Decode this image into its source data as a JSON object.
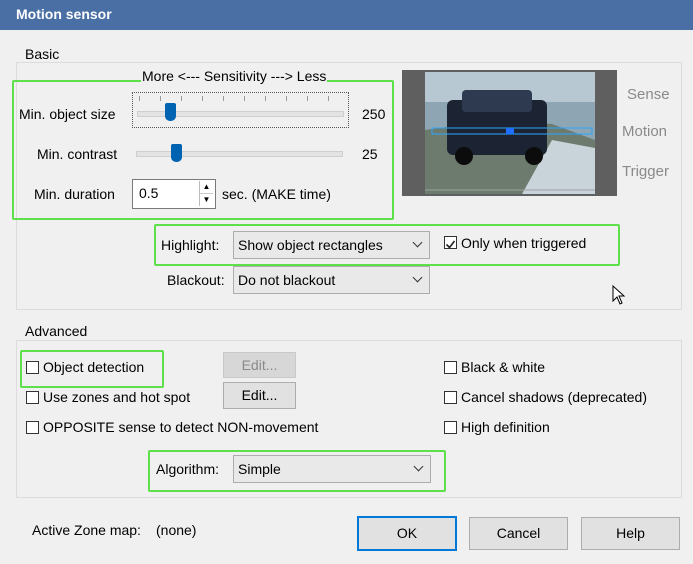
{
  "window": {
    "title": "Motion sensor"
  },
  "basic": {
    "legend": "Basic",
    "sensitivity_caption": "More <--- Sensitivity ---> Less",
    "min_object_size": {
      "label": "Min. object size",
      "value": "250"
    },
    "min_contrast": {
      "label": "Min. contrast",
      "value": "25"
    },
    "min_duration": {
      "label": "Min. duration",
      "value": "0.5",
      "unit": "sec.  (MAKE time)"
    },
    "highlight": {
      "label": "Highlight:",
      "selected": "Show object rectangles"
    },
    "only_when_triggered": {
      "label": "Only when triggered",
      "checked": true
    },
    "blackout": {
      "label": "Blackout:",
      "selected": "Do not blackout"
    },
    "side_labels": [
      "Sense",
      "Motion",
      "Trigger"
    ]
  },
  "advanced": {
    "legend": "Advanced",
    "object_detection": {
      "label": "Object detection",
      "checked": false
    },
    "object_detection_edit": "Edit...",
    "use_zones": {
      "label": "Use zones and hot spot",
      "checked": false
    },
    "use_zones_edit": "Edit...",
    "opposite_sense": {
      "label": "OPPOSITE sense to detect NON-movement",
      "checked": false
    },
    "black_white": {
      "label": "Black & white",
      "checked": false
    },
    "cancel_shadows": {
      "label": "Cancel shadows (deprecated)",
      "checked": false
    },
    "high_definition": {
      "label": "High definition",
      "checked": false
    },
    "algorithm": {
      "label": "Algorithm:",
      "selected": "Simple"
    }
  },
  "footer": {
    "active_zone_label": "Active Zone map:",
    "active_zone_value": "(none)",
    "ok": "OK",
    "cancel": "Cancel",
    "help": "Help"
  }
}
